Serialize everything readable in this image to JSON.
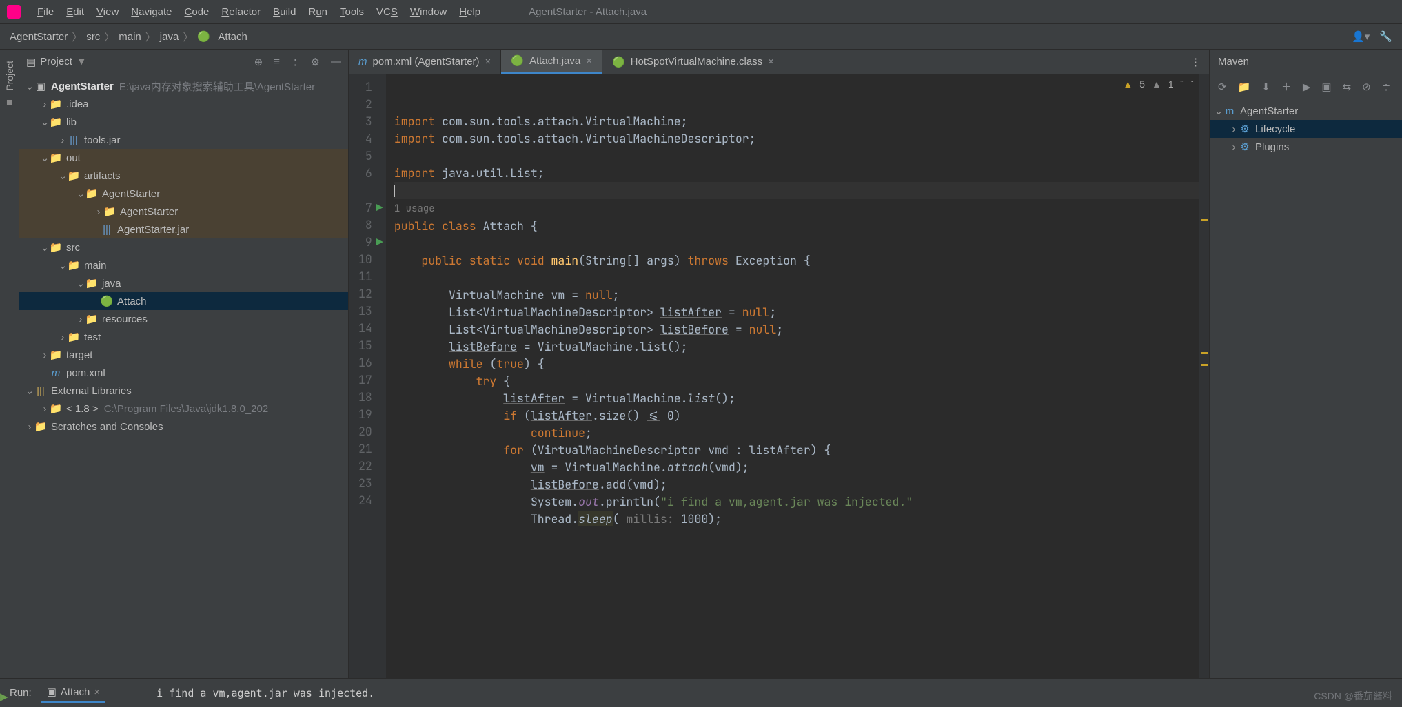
{
  "window_title": "AgentStarter - Attach.java",
  "menu": [
    "File",
    "Edit",
    "View",
    "Navigate",
    "Code",
    "Refactor",
    "Build",
    "Run",
    "Tools",
    "VCS",
    "Window",
    "Help"
  ],
  "breadcrumbs": [
    "AgentStarter",
    "src",
    "main",
    "java",
    "Attach"
  ],
  "project_panel": {
    "title": "Project",
    "root": {
      "name": "AgentStarter",
      "path": "E:\\java内存对象搜索辅助工具\\AgentStarter"
    },
    "idea": ".idea",
    "lib": "lib",
    "toolsjar": "tools.jar",
    "out": "out",
    "artifacts": "artifacts",
    "agentstarter1": "AgentStarter",
    "agentstarter2": "AgentStarter",
    "agentstarterjar": "AgentStarter.jar",
    "src": "src",
    "main_dir": "main",
    "java_dir": "java",
    "attach": "Attach",
    "resources": "resources",
    "test": "test",
    "target": "target",
    "pom": "pom.xml",
    "ext": "External Libraries",
    "jdk": "< 1.8 >",
    "jdk_path": "C:\\Program Files\\Java\\jdk1.8.0_202",
    "scratches": "Scratches and Consoles"
  },
  "tabs": [
    {
      "label": "pom.xml (AgentStarter)",
      "icon": "m"
    },
    {
      "label": "Attach.java",
      "icon": "c",
      "active": true
    },
    {
      "label": "HotSpotVirtualMachine.class",
      "icon": "c"
    }
  ],
  "inspections": {
    "warn_a": "5",
    "warn_b": "1"
  },
  "code": {
    "lines": 24,
    "usage": "1 usage",
    "l2": "import com.sun.tools.attach.VirtualMachine;",
    "l3": "import com.sun.tools.attach.VirtualMachineDescriptor;",
    "l5": "import java.util.List;",
    "l7_a": "public class",
    "l7_b": " Attach {",
    "l9_a": "public static void",
    "l9_b": " main",
    "l9_c": "(String[] args) ",
    "l9_d": "throws",
    "l9_e": " Exception {",
    "l11_a": "VirtualMachine ",
    "l11_b": "vm",
    "l11_c": " = ",
    "l11_d": "null",
    "l11_e": ";",
    "l12_a": "List<VirtualMachineDescriptor> ",
    "l12_b": "listAfter",
    "l12_c": " = ",
    "l12_d": "null",
    "l12_e": ";",
    "l13_a": "List<VirtualMachineDescriptor> ",
    "l13_b": "listBefore",
    "l13_c": " = ",
    "l13_d": "null",
    "l13_e": ";",
    "l14_a": "listBefore",
    "l14_b": " = VirtualMachine.list();",
    "l15_a": "while",
    "l15_b": " (",
    "l15_c": "true",
    "l15_d": ") {",
    "l16_a": "try",
    "l16_b": " {",
    "l17_a": "listAfter",
    "l17_b": " = VirtualMachine.",
    "l17_c": "list",
    "l17_d": "();",
    "l18_a": "if",
    "l18_b": " (",
    "l18_c": "listAfter",
    "l18_d": ".size() ",
    "l18_e": "<=",
    "l18_f": " 0)",
    "l19_a": "continue",
    "l19_b": ";",
    "l20_a": "for",
    "l20_b": " (VirtualMachineDescriptor vmd : ",
    "l20_c": "listAfter",
    "l20_d": ") {",
    "l21_a": "vm",
    "l21_b": " = VirtualMachine.",
    "l21_c": "attach",
    "l21_d": "(vmd);",
    "l22_a": "listBefore",
    "l22_b": ".add(vmd);",
    "l23_a": "System.",
    "l23_b": "out",
    "l23_c": ".println(",
    "l23_d": "\"i find a vm,agent.jar was injected.\"",
    "l24_a": "Thread.",
    "l24_b": "sleep",
    "l24_c": "( ",
    "l24_d": "millis: ",
    "l24_e": "1000);"
  },
  "maven": {
    "title": "Maven",
    "root": "AgentStarter",
    "lifecycle": "Lifecycle",
    "plugins": "Plugins"
  },
  "run": {
    "label": "Run:",
    "tab": "Attach",
    "output": "i find a vm,agent.jar was injected."
  },
  "watermark": "CSDN @番茄酱料"
}
